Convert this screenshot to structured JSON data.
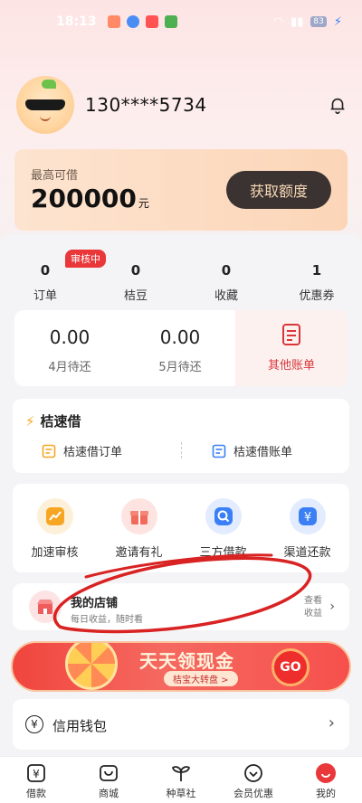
{
  "status_bar": {
    "time": "18:13",
    "battery": "83"
  },
  "profile": {
    "phone": "130****5734"
  },
  "quota": {
    "label": "最高可借",
    "amount": "200000",
    "unit": "元",
    "button": "获取额度"
  },
  "stats": [
    {
      "value": "0",
      "label": "订单",
      "badge": "审核中"
    },
    {
      "value": "0",
      "label": "桔豆"
    },
    {
      "value": "0",
      "label": "收藏"
    },
    {
      "value": "1",
      "label": "优惠券"
    }
  ],
  "bills": {
    "april": {
      "amount": "0.00",
      "label": "4月待还"
    },
    "may": {
      "amount": "0.00",
      "label": "5月待还"
    },
    "other": "其他账单"
  },
  "jsj": {
    "title": "桔速借",
    "orders": "桔速借订单",
    "bills": "桔速借账单"
  },
  "quick_actions": [
    {
      "label": "加速审核",
      "icon": "trend-up-icon",
      "color": "#f6a623"
    },
    {
      "label": "邀请有礼",
      "icon": "gift-icon",
      "color": "#f16a5a"
    },
    {
      "label": "三方借款",
      "icon": "search-icon",
      "color": "#3a7ff5"
    },
    {
      "label": "渠道还款",
      "icon": "yen-icon",
      "color": "#3a7ff5"
    }
  ],
  "shop": {
    "title": "我的店铺",
    "subtitle": "每日收益，随时看",
    "link_line1": "查看",
    "link_line2": "收益"
  },
  "banner": {
    "title": "天天领现金",
    "subtitle": "桔宝大转盘 >",
    "go": "GO"
  },
  "wallet": {
    "label": "信用钱包"
  },
  "tabs": [
    {
      "label": "借款",
      "icon": "yen-box-icon"
    },
    {
      "label": "商城",
      "icon": "bag-icon"
    },
    {
      "label": "种草社",
      "icon": "sprout-icon"
    },
    {
      "label": "会员优惠",
      "icon": "heart-shield-icon"
    },
    {
      "label": "我的",
      "icon": "profile-icon"
    }
  ],
  "colors": {
    "accent": "#d9363b",
    "dark_button": "#3b3331",
    "quota_card": "#fcd5b7"
  }
}
